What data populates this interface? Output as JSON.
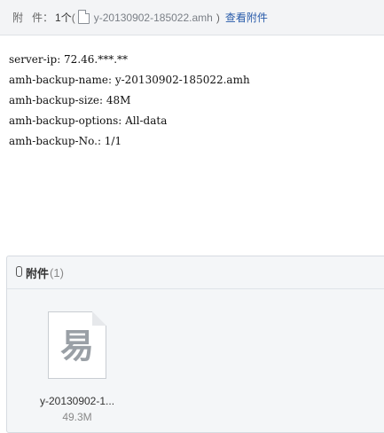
{
  "header": {
    "label": "附件",
    "colon": "：",
    "count": "1个",
    "open_paren": "(",
    "file_name": "y-20130902-185022.amh",
    "close_paren": ")",
    "view_link": "查看附件"
  },
  "body_lines": [
    "server-ip: 72.46.***.**",
    "amh-backup-name: y-20130902-185022.amh",
    "amh-backup-size: 48M",
    "amh-backup-options: All-data",
    "amh-backup-No.: 1/1"
  ],
  "attachments": {
    "title": "附件",
    "count": "(1)",
    "items": [
      {
        "name": "y-20130902-1...",
        "size": "49.3M",
        "icon": "file-doc-icon",
        "glyph": "易"
      }
    ]
  }
}
